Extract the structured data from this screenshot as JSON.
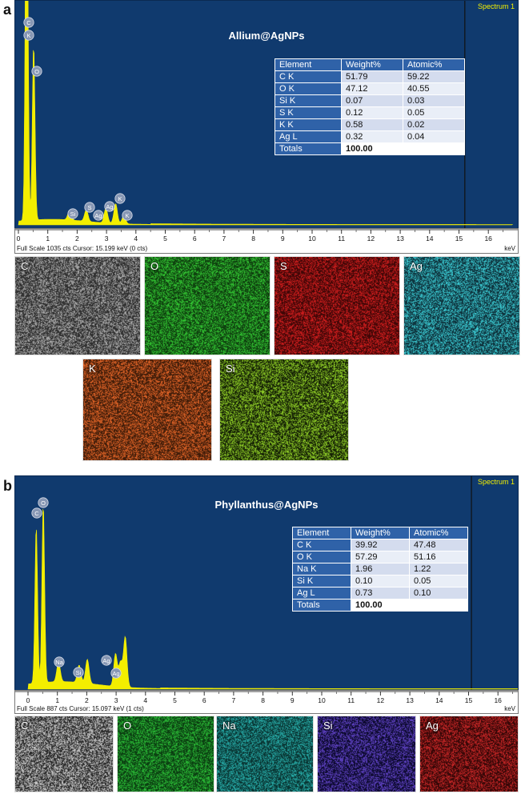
{
  "panels": [
    {
      "letter": "a",
      "title": "Allium@AgNPs",
      "tag": "Spectrum 1",
      "status": "Full Scale 1035 cts  Cursor: 15.199 keV (0 cts)",
      "unit": "keV",
      "table": {
        "headers": [
          "Element",
          "Weight%",
          "Atomic%"
        ],
        "rows": [
          [
            "C K",
            "51.79",
            "59.22"
          ],
          [
            "O K",
            "47.12",
            "40.55"
          ],
          [
            "Si K",
            "0.07",
            "0.03"
          ],
          [
            "S K",
            "0.12",
            "0.05"
          ],
          [
            "K K",
            "0.58",
            "0.02"
          ],
          [
            "Ag L",
            "0.32",
            "0.04"
          ],
          [
            "Totals",
            "100.00",
            ""
          ]
        ]
      },
      "maps": [
        {
          "label": "C",
          "color": "#b8b8b8",
          "bg": "#2a2a2a"
        },
        {
          "label": "O",
          "color": "#36d236",
          "bg": "#0d3a0d"
        },
        {
          "label": "S",
          "color": "#e02020",
          "bg": "#3a0606"
        },
        {
          "label": "Ag",
          "color": "#3fd8e0",
          "bg": "#0c2c36"
        },
        {
          "label": "K",
          "color": "#f26b2a",
          "bg": "#3a1a08"
        },
        {
          "label": "Si",
          "color": "#9ce02a",
          "bg": "#101a04"
        }
      ]
    },
    {
      "letter": "b",
      "title": "Phyllanthus@AgNPs",
      "tag": "Spectrum 1",
      "status": "Full Scale 887 cts  Cursor: 15.097 keV (1 cts)",
      "unit": "keV",
      "table": {
        "headers": [
          "Element",
          "Weight%",
          "Atomic%"
        ],
        "rows": [
          [
            "C K",
            "39.92",
            "47.48"
          ],
          [
            "O K",
            "57.29",
            "51.16"
          ],
          [
            "Na K",
            "1.96",
            "1.22"
          ],
          [
            "Si K",
            "0.10",
            "0.05"
          ],
          [
            "Ag L",
            "0.73",
            "0.10"
          ],
          [
            "Totals",
            "100.00",
            ""
          ]
        ]
      },
      "maps": [
        {
          "label": "C",
          "color": "#d8d8d8",
          "bg": "#222222"
        },
        {
          "label": "O",
          "color": "#2ec83a",
          "bg": "#0a3a10"
        },
        {
          "label": "Na",
          "color": "#2ab8b4",
          "bg": "#08302e"
        },
        {
          "label": "Si",
          "color": "#6a4ad8",
          "bg": "#0a082a"
        },
        {
          "label": "Ag",
          "color": "#d82a2a",
          "bg": "#300606"
        }
      ]
    }
  ],
  "chart_data": [
    {
      "type": "line",
      "title": "Allium@AgNPs",
      "xlabel": "keV",
      "ylabel": "cts",
      "xlim": [
        0,
        17
      ],
      "ylim": [
        0,
        1035
      ],
      "x_ticks": [
        0,
        1,
        2,
        3,
        4,
        5,
        6,
        7,
        8,
        9,
        10,
        11,
        12,
        13,
        14,
        15,
        16
      ],
      "cursor_kev": 15.199,
      "peaks": [
        {
          "element": "C",
          "kev": 0.28,
          "counts": 1010
        },
        {
          "element": "K",
          "kev": 0.28,
          "counts": 940
        },
        {
          "element": "O",
          "kev": 0.52,
          "counts": 840
        },
        {
          "element": "Si",
          "kev": 1.74,
          "counts": 45
        },
        {
          "element": "S",
          "kev": 2.31,
          "counts": 55
        },
        {
          "element": "Ag",
          "kev": 2.98,
          "counts": 70
        },
        {
          "element": "K",
          "kev": 3.31,
          "counts": 95
        },
        {
          "element": "K",
          "kev": 3.59,
          "counts": 40
        }
      ],
      "peak_labels": [
        "C",
        "K",
        "O",
        "Si",
        "S",
        "Ag",
        "Ag",
        "K",
        "K"
      ]
    },
    {
      "type": "line",
      "title": "Phyllanthus@AgNPs",
      "xlabel": "keV",
      "ylabel": "cts",
      "xlim": [
        0,
        17
      ],
      "ylim": [
        0,
        887
      ],
      "x_ticks": [
        0,
        1,
        2,
        3,
        4,
        5,
        6,
        7,
        8,
        9,
        10,
        11,
        12,
        13,
        14,
        15,
        16
      ],
      "cursor_kev": 15.097,
      "peaks": [
        {
          "element": "C",
          "kev": 0.28,
          "counts": 720
        },
        {
          "element": "O",
          "kev": 0.52,
          "counts": 820
        },
        {
          "element": "Na",
          "kev": 1.04,
          "counts": 90
        },
        {
          "element": "Si",
          "kev": 1.74,
          "counts": 80
        },
        {
          "element": "",
          "kev": 2.02,
          "counts": 110
        },
        {
          "element": "Ag",
          "kev": 2.98,
          "counts": 150
        },
        {
          "element": "Ag",
          "kev": 3.15,
          "counts": 110
        },
        {
          "element": "",
          "kev": 3.31,
          "counts": 230
        }
      ],
      "peak_labels": [
        "C",
        "O",
        "Na",
        "Si",
        "Ag",
        "Ag"
      ]
    }
  ]
}
